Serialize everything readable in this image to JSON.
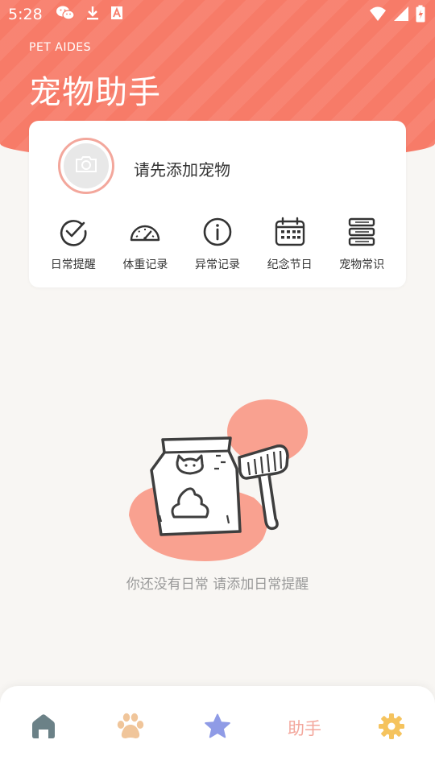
{
  "status_bar": {
    "time": "5:28",
    "left_icons": [
      "wechat-icon",
      "download-icon",
      "a-box-icon"
    ],
    "right_icons": [
      "wifi-icon",
      "signal-icon",
      "battery-charging-icon"
    ]
  },
  "header": {
    "subtitle": "PET AIDES",
    "title": "宠物助手",
    "color": "#f77b68"
  },
  "pet_card": {
    "avatar_icon": "camera-icon",
    "add_pet_text": "请先添加宠物",
    "quick_actions": [
      {
        "label": "日常提醒",
        "icon": "check-circle-icon"
      },
      {
        "label": "体重记录",
        "icon": "gauge-icon"
      },
      {
        "label": "异常记录",
        "icon": "info-icon"
      },
      {
        "label": "纪念节日",
        "icon": "calendar-icon"
      },
      {
        "label": "宠物常识",
        "icon": "database-icon"
      }
    ]
  },
  "empty_state": {
    "illustration": "pet-food-bag-and-scoop",
    "message": "你还没有日常 请添加日常提醒"
  },
  "bottom_nav": {
    "items": [
      {
        "name": "home",
        "icon": "home-icon",
        "color": "#6b8187"
      },
      {
        "name": "pets",
        "icon": "paw-icon",
        "color": "#f0c59a"
      },
      {
        "name": "favorites",
        "icon": "star-icon",
        "color": "#8f9be6"
      },
      {
        "name": "assistant",
        "label": "助手",
        "active": true,
        "color": "#f3a79c"
      },
      {
        "name": "settings",
        "icon": "gear-icon",
        "color": "#f5c35e"
      }
    ]
  }
}
